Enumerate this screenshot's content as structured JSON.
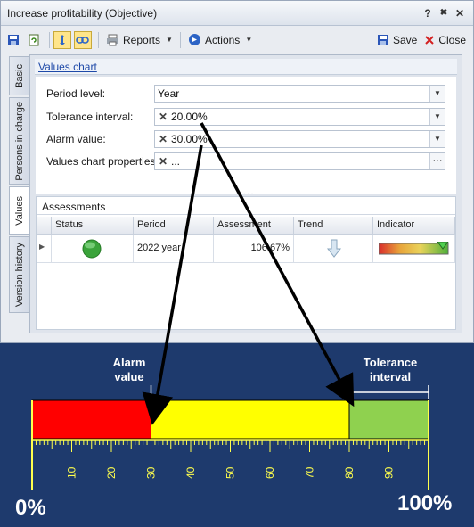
{
  "window": {
    "title": "Increase profitability (Objective)",
    "title_buttons": [
      "?",
      "✖",
      "✕"
    ]
  },
  "toolbar": {
    "reports_label": "Reports",
    "actions_label": "Actions",
    "save_label": "Save",
    "close_label": "Close"
  },
  "tabs": [
    {
      "label": "Basic",
      "selected": false
    },
    {
      "label": "Persons in charge",
      "selected": false
    },
    {
      "label": "Values",
      "selected": true
    },
    {
      "label": "Version history",
      "selected": false
    }
  ],
  "values_chart": {
    "link_label": "Values chart",
    "fields": [
      {
        "label": "Period level:",
        "value": "Year"
      },
      {
        "label": "Tolerance interval:",
        "value": "20.00%"
      },
      {
        "label": "Alarm value:",
        "value": "30.00%"
      },
      {
        "label": "Values chart properties:",
        "value": "..."
      }
    ]
  },
  "assessments": {
    "title": "Assessments",
    "columns": [
      "Status",
      "Period",
      "Assessment",
      "Trend",
      "Indicator"
    ],
    "rows": [
      {
        "status": "green",
        "period": "2022 year",
        "assessment": "106.67%",
        "trend": "down",
        "indicator_fraction": 1.0
      }
    ]
  },
  "illustration": {
    "alarm_label": "Alarm value",
    "tolerance_label": "Tolerance interval",
    "min_label": "0%",
    "max_label": "100%",
    "alarm_value": 30,
    "tolerance_value": 20,
    "tick_labels": [
      "10",
      "20",
      "30",
      "40",
      "50",
      "60",
      "70",
      "80",
      "90"
    ],
    "colors": {
      "red": "#ff0000",
      "yellow": "#ffff00",
      "green": "#8fd14f",
      "background": "#1e3a6d",
      "scale": "#ffff4d"
    }
  }
}
